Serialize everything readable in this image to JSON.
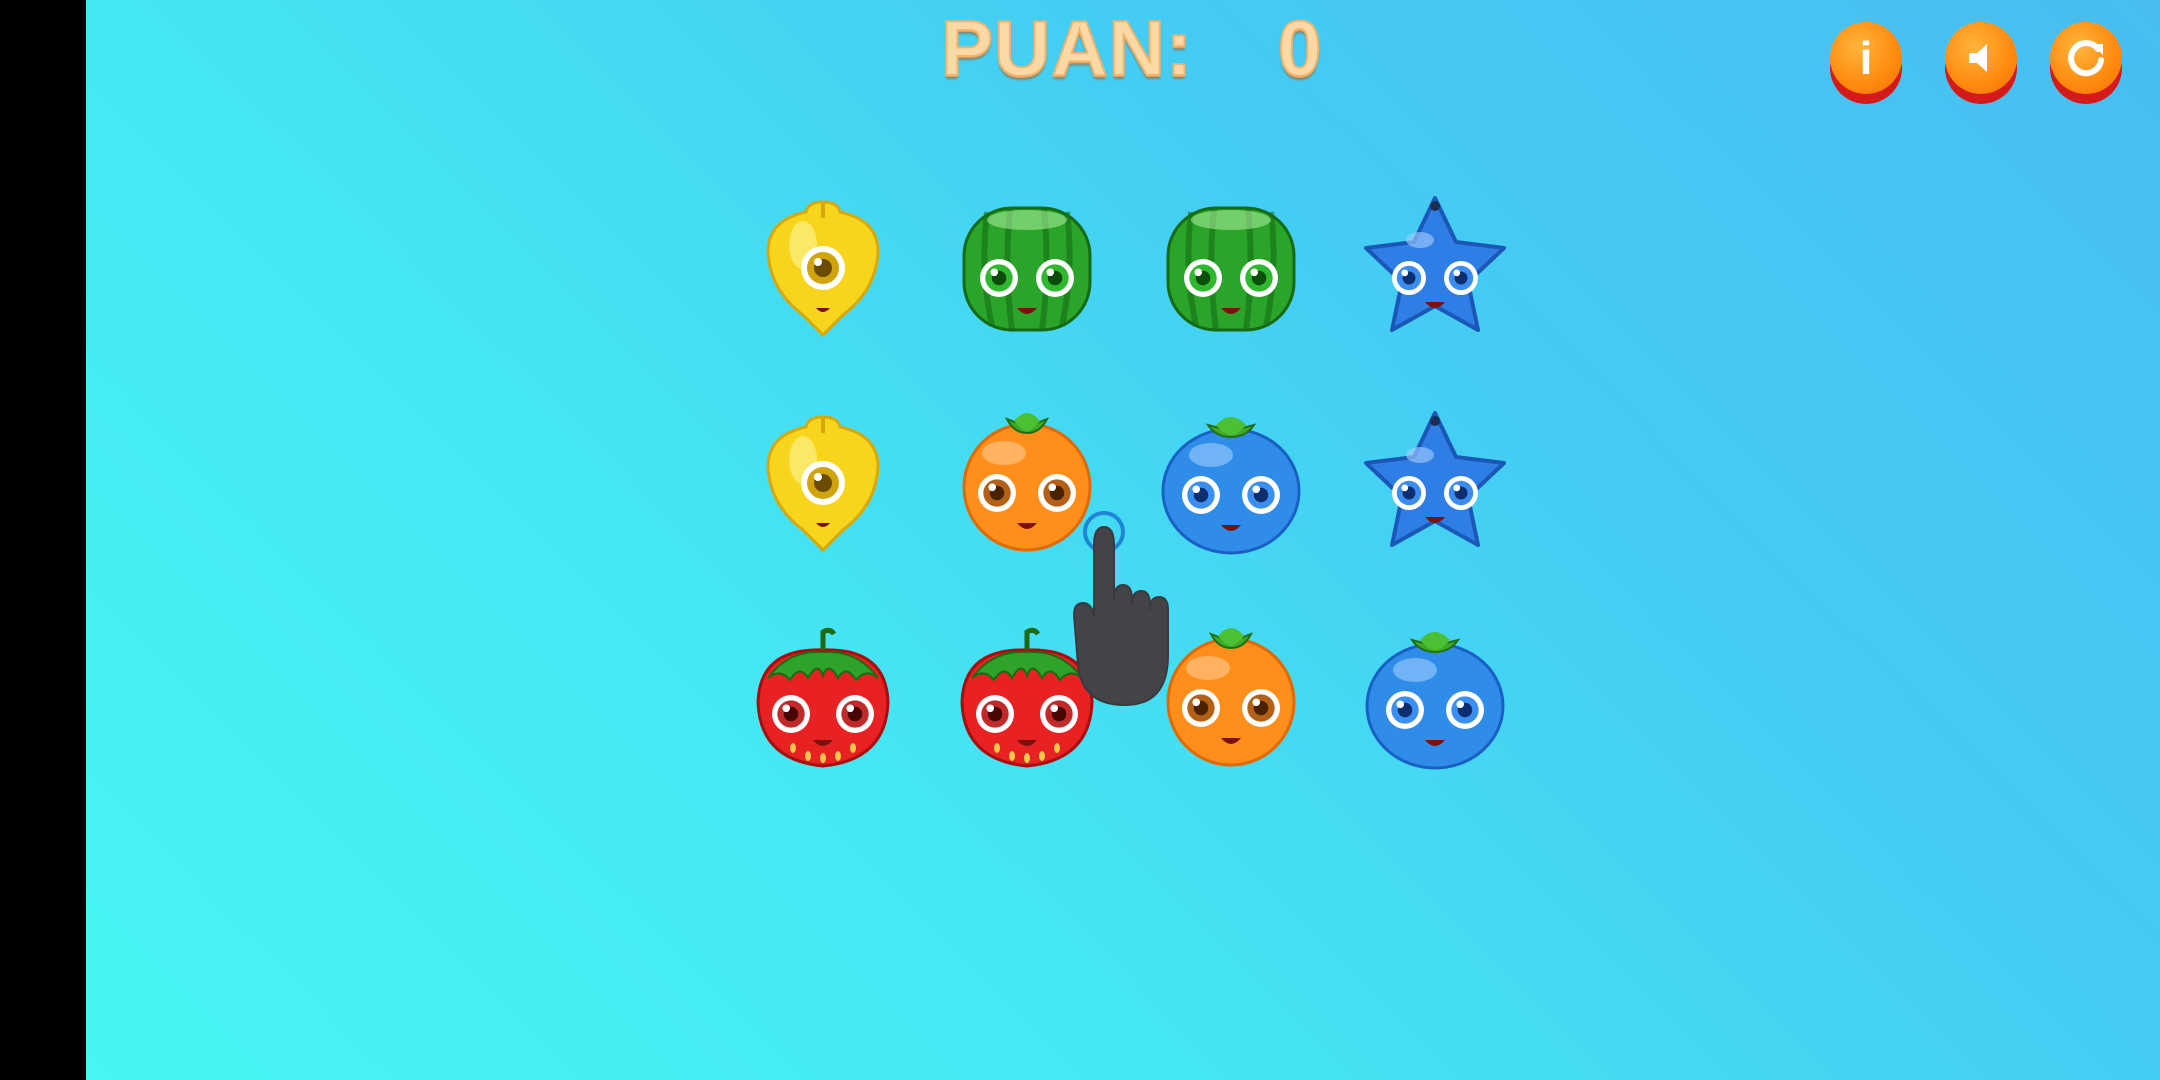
{
  "score": {
    "label": "PUAN:",
    "value": "0"
  },
  "buttons": {
    "info": {
      "icon": "info-icon",
      "glyph": "i"
    },
    "sound": {
      "icon": "speaker-icon"
    },
    "restart": {
      "icon": "restart-icon"
    }
  },
  "board": {
    "rows": [
      [
        "pepper",
        "watermelon",
        "watermelon",
        "starfruit"
      ],
      [
        "pepper",
        "orange",
        "blueberry",
        "starfruit"
      ],
      [
        "strawberry",
        "strawberry",
        "orange",
        "blueberry"
      ]
    ]
  },
  "hint": {
    "icon": "pointing-hand-icon"
  },
  "colors": {
    "accent_orange": "#ff8a10",
    "score_text": "#fbd9a6"
  }
}
